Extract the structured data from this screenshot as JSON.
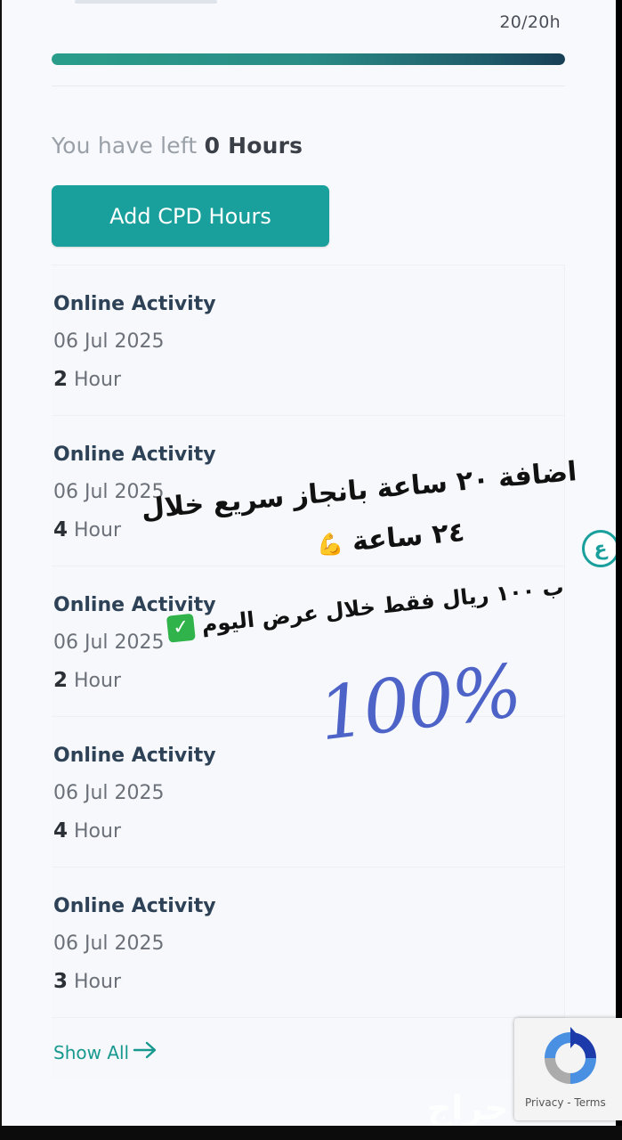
{
  "progress": {
    "count_text": "20/20h",
    "fraction": 1.0
  },
  "remaining": {
    "prefix": "You have left",
    "value": "0 Hours"
  },
  "add_button": {
    "label": "Add CPD Hours"
  },
  "activities": [
    {
      "title": "Online Activity",
      "date": "06 Jul 2025",
      "hours": "2",
      "unit": "Hour"
    },
    {
      "title": "Online Activity",
      "date": "06 Jul 2025",
      "hours": "4",
      "unit": "Hour"
    },
    {
      "title": "Online Activity",
      "date": "06 Jul 2025",
      "hours": "2",
      "unit": "Hour"
    },
    {
      "title": "Online Activity",
      "date": "06 Jul 2025",
      "hours": "4",
      "unit": "Hour"
    },
    {
      "title": "Online Activity",
      "date": "06 Jul 2025",
      "hours": "3",
      "unit": "Hour"
    }
  ],
  "show_all": {
    "label": "Show All",
    "icon": "arrow-right-icon"
  },
  "translate_icon": {
    "glyph": "ع",
    "icon": "translate-icon"
  },
  "recaptcha": {
    "links": "Privacy - Terms",
    "icon": "recaptcha-logo-icon"
  },
  "overlay": {
    "line1": "اضافة ٢٠ ساعة بانجاز سريع خلال",
    "line2": "٢٤ ساعة",
    "line3": "ب ١٠٠ ريال فقط خلال عرض اليوم",
    "percent": "100%"
  },
  "watermark": {
    "text": "حراج"
  },
  "colors": {
    "accent": "#1aa09c",
    "title": "#2e4257",
    "percent_ink": "#4d63c8"
  }
}
